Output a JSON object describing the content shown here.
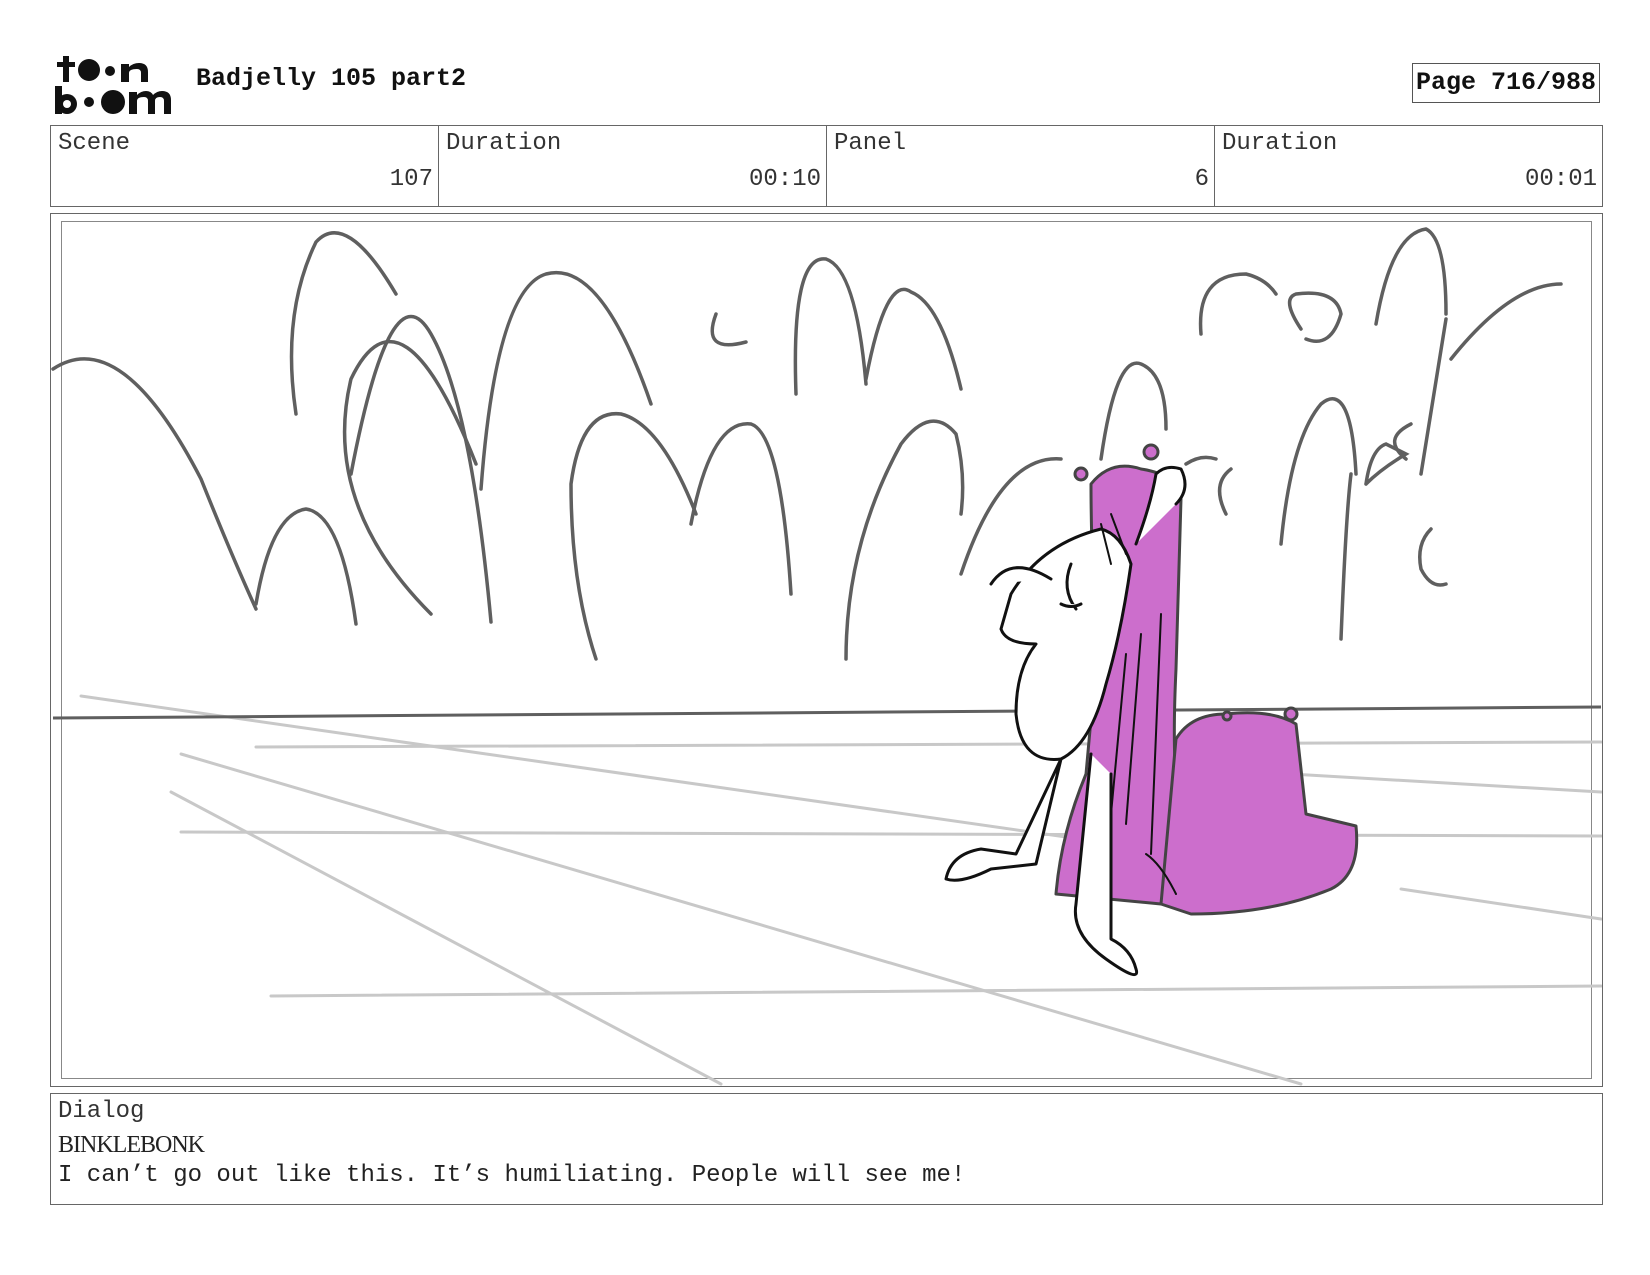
{
  "header": {
    "logo_text": "toonboom",
    "project_title": "Badjelly 105 part2",
    "page_label": "Page 716/988"
  },
  "info": {
    "scene_label": "Scene",
    "scene_value": "107",
    "scene_duration_label": "Duration",
    "scene_duration_value": "00:10",
    "panel_label": "Panel",
    "panel_value": "6",
    "panel_duration_label": "Duration",
    "panel_duration_value": "00:01"
  },
  "dialog": {
    "label": "Dialog",
    "speaker": "BINKLEBONK",
    "line": "I can’t go out like this. It’s humiliating. People will see me!"
  },
  "colors": {
    "fill_magenta": "#cc6ecc",
    "bush_stroke": "#5f5f5f",
    "ground_stroke": "#c8c8c8"
  }
}
